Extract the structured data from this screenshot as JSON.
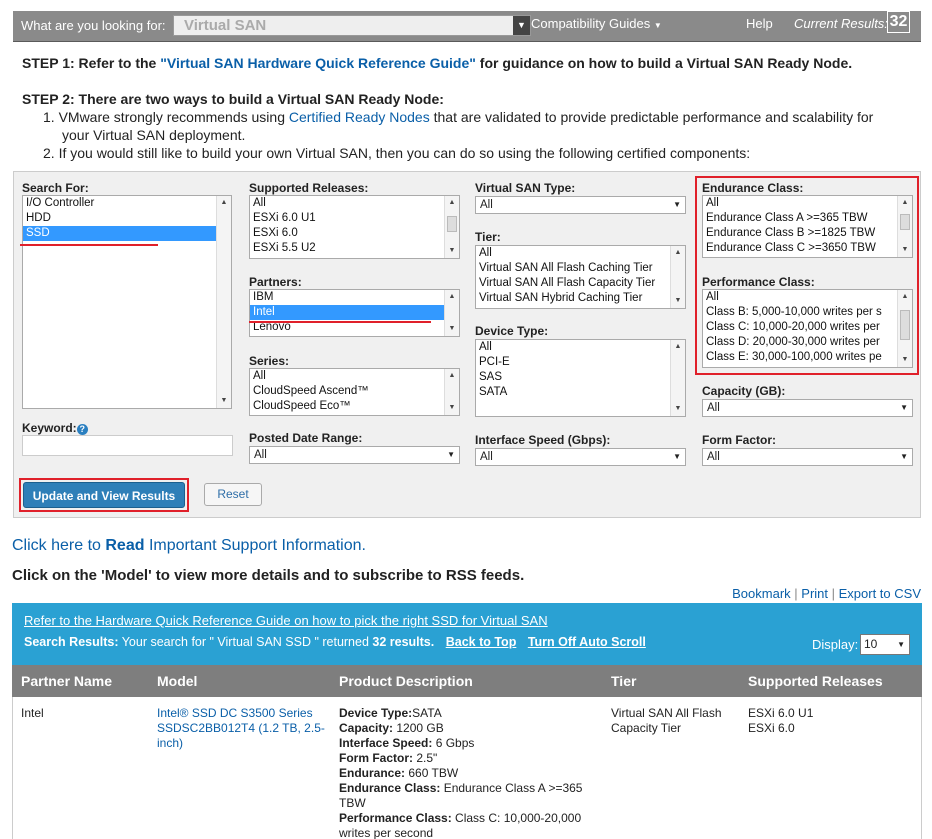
{
  "topbar": {
    "question": "What are you looking for:",
    "search_value": "Virtual SAN",
    "compat": "Compatibility Guides",
    "help": "Help",
    "current_label": "Current Results:",
    "current_count": "32"
  },
  "steps": {
    "s1_prefix": "STEP 1: Refer to the ",
    "s1_link": "\"Virtual SAN Hardware Quick Reference Guide\"",
    "s1_suffix": " for guidance on how to build a Virtual SAN Ready Node.",
    "s2": "STEP 2: There are two ways to build a Virtual SAN Ready Node:",
    "i1_prefix": "1.  VMware strongly recommends using ",
    "i1_link": "Certified Ready Nodes",
    "i1_suffix": " that are validated to provide predictable performance and scalability for",
    "i1_line2": "your Virtual SAN deployment.",
    "i2": "2.  If you would still like to build your own Virtual SAN, then you can do so using the following certified components:"
  },
  "filters": {
    "search_for": {
      "label": "Search For:",
      "options": [
        "I/O Controller",
        "HDD",
        "SSD"
      ]
    },
    "releases": {
      "label": "Supported Releases:",
      "options": [
        "All",
        "ESXi 6.0 U1",
        "ESXi 6.0",
        "ESXi 5.5 U2"
      ]
    },
    "partners": {
      "label": "Partners:",
      "options": [
        "IBM",
        "Intel",
        "Lenovo"
      ]
    },
    "series": {
      "label": "Series:",
      "options": [
        "All",
        "CloudSpeed Ascend™",
        "CloudSpeed Eco™"
      ]
    },
    "keyword": {
      "label": "Keyword:"
    },
    "posted": {
      "label": "Posted Date Range:",
      "value": "All"
    },
    "vsan_type": {
      "label": "Virtual SAN Type:",
      "value": "All"
    },
    "tier": {
      "label": "Tier:",
      "options": [
        "All",
        "Virtual SAN All Flash Caching Tier",
        "Virtual SAN All Flash Capacity Tier",
        "Virtual SAN Hybrid Caching Tier"
      ]
    },
    "device_type": {
      "label": "Device Type:",
      "options": [
        "All",
        "PCI-E",
        "SAS",
        "SATA"
      ]
    },
    "interface": {
      "label": "Interface Speed (Gbps):",
      "value": "All"
    },
    "endurance": {
      "label": "Endurance Class:",
      "options": [
        "All",
        "Endurance Class A >=365 TBW",
        "Endurance Class B >=1825 TBW",
        "Endurance Class C >=3650 TBW"
      ]
    },
    "performance": {
      "label": "Performance Class:",
      "options": [
        "All",
        "Class B: 5,000-10,000 writes per s",
        "Class C: 10,000-20,000 writes per",
        "Class D: 20,000-30,000 writes per",
        "Class E: 30,000-100,000 writes pe"
      ]
    },
    "capacity": {
      "label": "Capacity (GB):",
      "value": "All"
    },
    "form_factor": {
      "label": "Form Factor:",
      "value": "All"
    },
    "update_btn": "Update and View Results",
    "reset_btn": "Reset"
  },
  "support": {
    "prefix": "Click here to ",
    "bold": "Read",
    "suffix": " Important Support Information."
  },
  "click_note": "Click on the 'Model' to view more details and to subscribe to RSS feeds.",
  "links": {
    "bookmark": "Bookmark",
    "print": "Print",
    "csv": "Export to CSV"
  },
  "banner": {
    "guide": "Refer to the Hardware Quick Reference Guide on how to pick the right SSD for Virtual SAN",
    "sr_label": "Search Results:",
    "sr_text": " Your search for \" Virtual SAN SSD \" returned ",
    "sr_count": "32 results.",
    "back": "Back to Top",
    "auto": "Turn Off Auto Scroll",
    "display_label": "Display:",
    "display_value": "10"
  },
  "table": {
    "headers": [
      "Partner Name",
      "Model",
      "Product Description",
      "Tier",
      "Supported Releases"
    ],
    "row": {
      "partner": "Intel",
      "model": "Intel® SSD DC S3500 Series SSDSC2BB012T4 (1.2 TB, 2.5-inch)",
      "desc": [
        {
          "k": "Device Type:",
          "v": "SATA"
        },
        {
          "k": "Capacity:",
          "v": " 1200 GB"
        },
        {
          "k": "Interface Speed:",
          "v": " 6 Gbps"
        },
        {
          "k": "Form Factor:",
          "v": " 2.5\""
        },
        {
          "k": "Endurance:",
          "v": " 660 TBW"
        },
        {
          "k": "Endurance Class:",
          "v": " Endurance Class A >=365 TBW"
        },
        {
          "k": "Performance Class:",
          "v": " Class C: 10,000-20,000 writes per second"
        }
      ],
      "tier": "Virtual SAN All Flash Capacity Tier",
      "releases": [
        "ESXi 6.0 U1",
        "ESXi 6.0"
      ]
    }
  }
}
